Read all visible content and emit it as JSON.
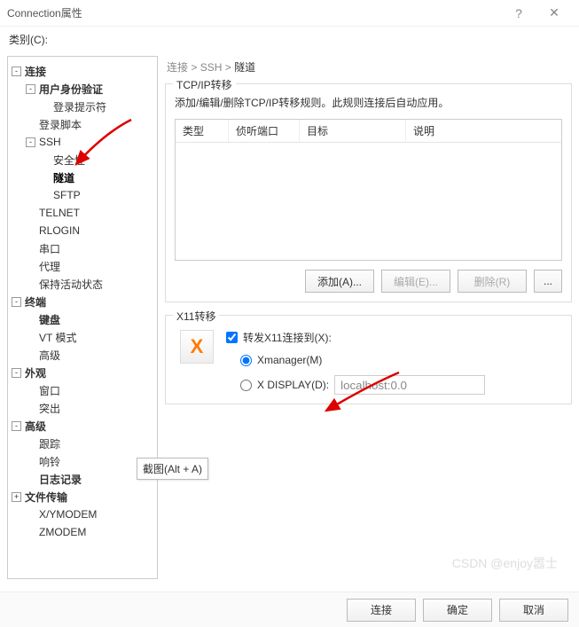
{
  "window": {
    "title": "Connection属性",
    "help": "?",
    "close": "✕"
  },
  "category_label": "类别(C):",
  "tree": [
    {
      "label": "连接",
      "depth": 0,
      "toggle": "-",
      "bold": true
    },
    {
      "label": "用户身份验证",
      "depth": 1,
      "toggle": "-",
      "bold": true
    },
    {
      "label": "登录提示符",
      "depth": 2
    },
    {
      "label": "登录脚本",
      "depth": 1
    },
    {
      "label": "SSH",
      "depth": 1,
      "toggle": "-"
    },
    {
      "label": "安全性",
      "depth": 2
    },
    {
      "label": "隧道",
      "depth": 2,
      "bold": true,
      "selected": true
    },
    {
      "label": "SFTP",
      "depth": 2
    },
    {
      "label": "TELNET",
      "depth": 1
    },
    {
      "label": "RLOGIN",
      "depth": 1
    },
    {
      "label": "串口",
      "depth": 1
    },
    {
      "label": "代理",
      "depth": 1
    },
    {
      "label": "保持活动状态",
      "depth": 1
    },
    {
      "label": "终端",
      "depth": 0,
      "toggle": "-",
      "bold": true
    },
    {
      "label": "键盘",
      "depth": 1,
      "bold": true
    },
    {
      "label": "VT 模式",
      "depth": 1
    },
    {
      "label": "高级",
      "depth": 1
    },
    {
      "label": "外观",
      "depth": 0,
      "toggle": "-",
      "bold": true
    },
    {
      "label": "窗口",
      "depth": 1
    },
    {
      "label": "突出",
      "depth": 1
    },
    {
      "label": "高级",
      "depth": 0,
      "toggle": "-",
      "bold": true
    },
    {
      "label": "跟踪",
      "depth": 1
    },
    {
      "label": "响铃",
      "depth": 1
    },
    {
      "label": "日志记录",
      "depth": 1,
      "bold": true
    },
    {
      "label": "文件传输",
      "depth": 0,
      "toggle": "+",
      "bold": true
    },
    {
      "label": "X/YMODEM",
      "depth": 1
    },
    {
      "label": "ZMODEM",
      "depth": 1
    }
  ],
  "breadcrumb": {
    "a": "连接",
    "b": "SSH",
    "c": "隧道",
    "sep": " > "
  },
  "tcpip": {
    "title": "TCP/IP转移",
    "desc": "添加/编辑/删除TCP/IP转移规则。此规则连接后自动应用。",
    "headers": [
      "类型",
      "侦听端口",
      "目标",
      "说明"
    ],
    "buttons": {
      "add": "添加(A)...",
      "edit": "编辑(E)...",
      "remove": "删除(R)",
      "more": "..."
    }
  },
  "x11": {
    "title": "X11转移",
    "forward_label": "转发X11连接到(X):",
    "opt_xmanager": "Xmanager(M)",
    "opt_xdisplay": "X DISPLAY(D):",
    "display_value": "localhost:0.0",
    "icon": "X"
  },
  "footer": {
    "connect": "连接",
    "ok": "确定",
    "cancel": "取消"
  },
  "tooltip": "截图(Alt + A)",
  "watermark": "CSDN @enjoy嚣士"
}
